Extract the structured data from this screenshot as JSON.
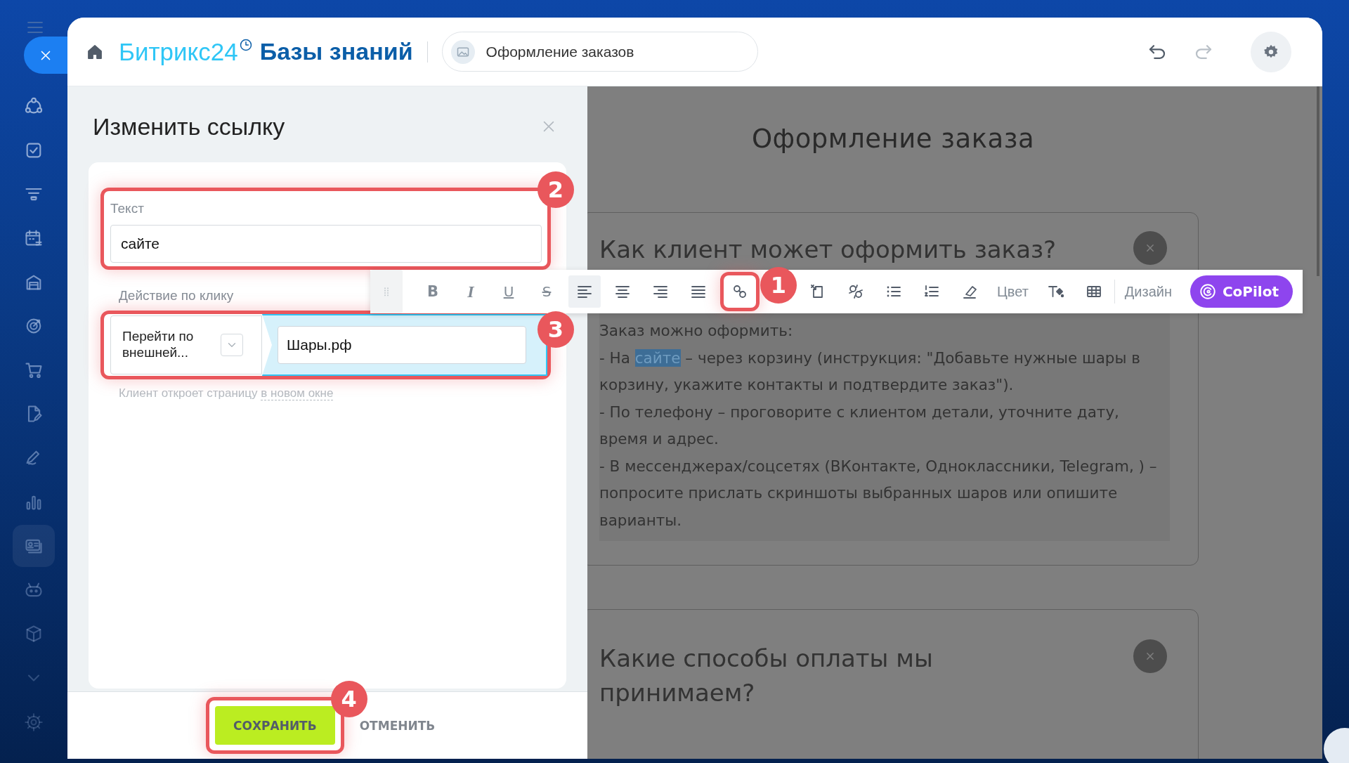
{
  "sidebar": {
    "items": [
      {
        "kind": "network",
        "selected": false
      },
      {
        "kind": "task",
        "selected": false
      },
      {
        "kind": "funnel",
        "selected": false
      },
      {
        "kind": "calendar",
        "selected": false
      },
      {
        "kind": "store",
        "selected": false
      },
      {
        "kind": "target",
        "selected": false
      },
      {
        "kind": "cart",
        "selected": false
      },
      {
        "kind": "document",
        "selected": false
      },
      {
        "kind": "pen",
        "selected": false
      },
      {
        "kind": "chart",
        "selected": false
      },
      {
        "kind": "contact-card",
        "selected": true
      },
      {
        "kind": "robot",
        "selected": false
      },
      {
        "kind": "box",
        "selected": false
      },
      {
        "kind": "more",
        "selected": false
      },
      {
        "kind": "settings",
        "selected": false
      }
    ]
  },
  "header": {
    "brand": "Битрикс24",
    "product": "Базы знаний",
    "breadcrumb": "Оформление заказов",
    "undo": {
      "disabled": false
    },
    "redo": {
      "disabled": true
    }
  },
  "link_dialog": {
    "title": "Изменить ссылку",
    "text_label": "Текст",
    "text_value": "сайте",
    "text_callout": "2",
    "action_label": "Действие по клику",
    "action_select": "Перейти по внешней...",
    "url_value": "Шары.рф",
    "action_callout": "3",
    "hint": "Клиент откроет страницу",
    "hint_link": "в новом окне",
    "buttons": [
      {
        "kind": "primary",
        "label": "СОХРАНИТЬ",
        "callout": "4"
      },
      {
        "kind": "link",
        "label": "ОТМЕНИТЬ"
      }
    ]
  },
  "toolbar": {
    "items": [
      {
        "kind": "drag"
      },
      {
        "kind": "bold",
        "label": "B",
        "selected": false
      },
      {
        "kind": "italic",
        "label": "I",
        "selected": false
      },
      {
        "kind": "underline",
        "label": "U",
        "selected": false
      },
      {
        "kind": "strike",
        "label": "S",
        "selected": false
      },
      {
        "kind": "align-left",
        "selected": true
      },
      {
        "kind": "align-center",
        "selected": false
      },
      {
        "kind": "align-right",
        "selected": false
      },
      {
        "kind": "justify",
        "selected": false
      },
      {
        "kind": "link",
        "selected": false,
        "callout": "1"
      },
      {
        "kind": "image",
        "selected": false
      },
      {
        "kind": "unlink",
        "selected": false
      },
      {
        "kind": "bullets",
        "selected": false
      },
      {
        "kind": "numbers",
        "selected": false
      },
      {
        "kind": "eraser",
        "selected": false
      },
      {
        "kind": "text",
        "label": "Цвет",
        "selected": false
      },
      {
        "kind": "text-style",
        "selected": false
      },
      {
        "kind": "table",
        "selected": false
      },
      {
        "kind": "separator"
      },
      {
        "kind": "text",
        "label": "Дизайн",
        "selected": false
      },
      {
        "kind": "copilot",
        "label": "CoPilot"
      }
    ]
  },
  "page": {
    "title": "Оформление заказа",
    "sections": [
      {
        "heading": "Как клиент может оформить заказ?",
        "lines": [
          {
            "segments": [
              {
                "text": "Заказ можно оформить:",
                "selected": false
              }
            ]
          },
          {
            "segments": [
              {
                "text": "- На ",
                "selected": false
              },
              {
                "text": "сайте",
                "selected": true
              },
              {
                "text": " – через корзину (инструкция: \"Добавьте нужные шары в корзину, укажите контакты и подтвердите заказ\").",
                "selected": false
              }
            ]
          },
          {
            "segments": [
              {
                "text": "- По телефону – проговорите с клиентом детали, уточните дату, время и адрес.",
                "selected": false
              }
            ]
          },
          {
            "segments": [
              {
                "text": "- В мессенджерах/соцсетях (ВКонтакте, Одноклассники, Telegram, ) – попросите прислать скриншоты выбранных шаров или опишите варианты.",
                "selected": false
              }
            ]
          }
        ]
      },
      {
        "heading": "Какие способы оплаты мы принимаем?"
      }
    ]
  }
}
